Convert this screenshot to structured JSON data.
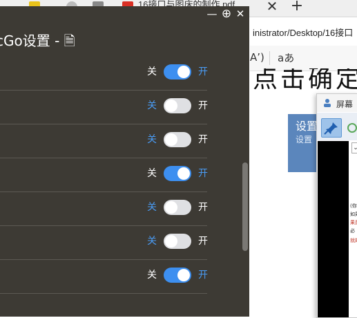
{
  "browser": {
    "tab_title": "16接口与图床的制作.pdf",
    "tab_close": "✕",
    "new_tab": "+",
    "address": "inistrator/Desktop/16接口",
    "read_aloud": "A’)",
    "text_size": "aあ",
    "doc_heading": "点击确定",
    "card_title": "设置",
    "card_subtitle": "设置"
  },
  "mini_window": {
    "title": "屏幕",
    "dropdown": "⌄",
    "doc_lines": [
      "(你",
      "如果",
      "果是,",
      "必",
      "就的"
    ]
  },
  "panel": {
    "title": "cGo设置 - 🗎",
    "minimize": "—",
    "pin": "⊕",
    "close": "✕",
    "toggles": [
      {
        "off": "关",
        "on": "开",
        "state": "on"
      },
      {
        "off": "关",
        "on": "开",
        "state": "off"
      },
      {
        "off": "关",
        "on": "开",
        "state": "off"
      },
      {
        "off": "关",
        "on": "开",
        "state": "on"
      },
      {
        "off": "关",
        "on": "开",
        "state": "off"
      },
      {
        "off": "关",
        "on": "开",
        "state": "off"
      },
      {
        "off": "关",
        "on": "开",
        "state": "on"
      }
    ]
  },
  "colors": {
    "panel_bg": "#3d3a34",
    "accent": "#3d8ff0",
    "toggle_off": "#dfe0e3",
    "active_label": "#ffffff",
    "inactive_label": "#4a9cf5"
  }
}
